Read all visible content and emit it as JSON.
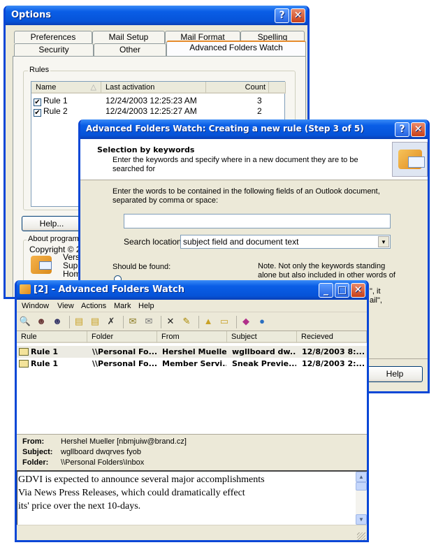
{
  "options": {
    "title": "Options",
    "tabs_row1": [
      "Preferences",
      "Mail Setup",
      "Mail Format",
      "Spelling"
    ],
    "tabs_row2": [
      "Security",
      "Other",
      "Advanced Folders Watch"
    ],
    "rules_group": "Rules",
    "columns": [
      "Name",
      "Last activation",
      "Count"
    ],
    "rules": [
      {
        "name": "Rule 1",
        "last": "12/24/2003 12:25:23 AM",
        "count": "3",
        "checked": true
      },
      {
        "name": "Rule 2",
        "last": "12/24/2003 12:25:27 AM",
        "count": "2",
        "checked": true
      }
    ],
    "help_button": "Help...",
    "about_group": "About program...",
    "copyright": "Copyright © 200",
    "about_lines": [
      "Versio",
      "Supp",
      "Home"
    ]
  },
  "wizard": {
    "title": "Advanced Folders Watch: Creating a new rule (Step 3 of 5)",
    "heading": "Selection by keywords",
    "subheading1": "Enter the keywords and specify where in a new document they are to be",
    "subheading2": "searched for",
    "instruction1": "Enter the words to be contained in the following fields of an Outlook document,",
    "instruction2": "separated by comma or space:",
    "keywords_value": "",
    "search_location_label": "Search location:",
    "search_location_value": "subject field and document text",
    "should_be_found": "Should be found:",
    "note1": "Note. Not only the keywords standing",
    "note2": "alone but also included in other words of",
    "note_frag1": "\", it",
    "note_frag2": "ail\",",
    "help_button": "Help"
  },
  "main": {
    "title": "[2] - Advanced Folders Watch",
    "menu": [
      "Window",
      "View",
      "Actions",
      "Mark",
      "Help"
    ],
    "toolbar": [
      "find-icon",
      "user-back-icon",
      "user-forward-icon",
      "|",
      "new-folder-icon",
      "copy-folder-icon",
      "delete-folder-icon",
      "|",
      "mark-read-icon",
      "mark-unread-icon",
      "|",
      "delete-icon",
      "clear-icon",
      "|",
      "export-icon",
      "open-folder-icon",
      "|",
      "help-book-icon",
      "web-icon"
    ],
    "columns": [
      "Rule",
      "Folder",
      "From",
      "Subject",
      "Recieved"
    ],
    "rows": [
      {
        "rule": "Rule 1",
        "folder": "\\\\Personal Fo...",
        "from": "Hershel Mueller",
        "subject": "wgllboard dw...",
        "received": "12/8/2003 8:..."
      },
      {
        "rule": "Rule 1",
        "folder": "\\\\Personal Fo...",
        "from": "Member Servi...",
        "subject": "Sneak Previe...",
        "received": "12/8/2003 2:..."
      }
    ],
    "preview": {
      "from_label": "From:",
      "from": "Hershel Mueller [nbmjuiw@brand.cz]",
      "subject_label": "Subject:",
      "subject": "wgllboard dwqrves fyob",
      "folder_label": "Folder:",
      "folder": "\\\\Personal Folders\\Inbox",
      "body": [
        "GDVI is expected to announce several major accomplishments",
        "Via News Press Releases, which could dramatically effect",
        "its' price over the next 10-days."
      ]
    }
  }
}
